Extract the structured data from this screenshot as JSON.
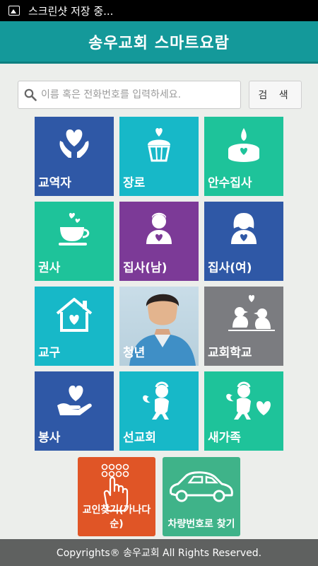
{
  "status_bar": {
    "notification": "스크린샷 저장 중...",
    "icon": "image-icon"
  },
  "header": {
    "title": "송우교회 스마트요람"
  },
  "search": {
    "placeholder": "이름 혹은 전화번호를 입력하세요.",
    "button_label": "검 색"
  },
  "tiles": [
    {
      "label": "교역자",
      "icon": "hands-heart-icon"
    },
    {
      "label": "장로",
      "icon": "cupcake-heart-icon"
    },
    {
      "label": "안수집사",
      "icon": "candle-heart-icon"
    },
    {
      "label": "권사",
      "icon": "teacup-heart-icon"
    },
    {
      "label": "집사(남)",
      "icon": "man-heart-icon"
    },
    {
      "label": "집사(여)",
      "icon": "woman-heart-icon"
    },
    {
      "label": "교구",
      "icon": "house-heart-icon"
    },
    {
      "label": "청년",
      "icon": "young-man-photo"
    },
    {
      "label": "교회학교",
      "icon": "lovebirds-icon"
    },
    {
      "label": "봉사",
      "icon": "hand-heart-icon"
    },
    {
      "label": "선교회",
      "icon": "cherub-icon"
    },
    {
      "label": "새가족",
      "icon": "cherub-heart-icon"
    }
  ],
  "bottom_buttons": [
    {
      "label": "교인찾기(가나다순)",
      "icon": "keypad-hand-icon",
      "color": "#e05526"
    },
    {
      "label": "차량번호로 찾기",
      "icon": "car-icon",
      "color": "#3fb389"
    }
  ],
  "footer": {
    "text": "Copyrights® 송우교회 All Rights Reserved."
  }
}
